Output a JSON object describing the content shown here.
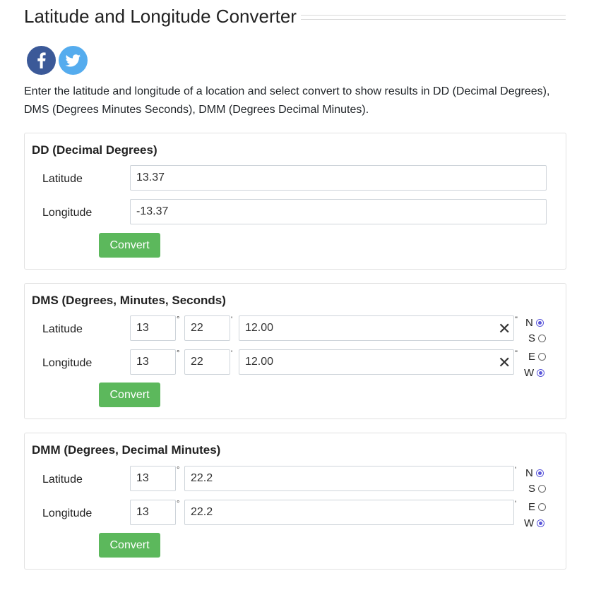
{
  "page": {
    "title": "Latitude and Longitude Converter",
    "intro": "Enter the latitude and longitude of a location and select convert to show results in DD (Decimal Degrees), DMS (Degrees Minutes Seconds), DMM (Degrees Decimal Minutes)."
  },
  "social": {
    "facebook_icon": "facebook-icon",
    "twitter_icon": "twitter-icon",
    "facebook_color": "#3b5998",
    "twitter_color": "#55acee"
  },
  "dd": {
    "title": "DD (Decimal Degrees)",
    "latitude_label": "Latitude",
    "longitude_label": "Longitude",
    "latitude_value": "13.37",
    "longitude_value": "-13.37",
    "convert_label": "Convert"
  },
  "dms": {
    "title": "DMS (Degrees, Minutes, Seconds)",
    "latitude_label": "Latitude",
    "longitude_label": "Longitude",
    "lat_degrees": "13",
    "lat_minutes": "22",
    "lat_seconds": "12.00",
    "lon_degrees": "13",
    "lon_minutes": "22",
    "lon_seconds": "12.00",
    "degree_symbol": "°",
    "minute_symbol": "'",
    "second_symbol": "\"",
    "clear_glyph": "✕",
    "convert_label": "Convert",
    "directions": {
      "n": "N",
      "s": "S",
      "e": "E",
      "w": "W"
    },
    "lat_direction_selected": "N",
    "lon_direction_selected": "W"
  },
  "dmm": {
    "title": "DMM (Degrees, Decimal Minutes)",
    "latitude_label": "Latitude",
    "longitude_label": "Longitude",
    "lat_degrees": "13",
    "lat_minutes": "22.2",
    "lon_degrees": "13",
    "lon_minutes": "22.2",
    "degree_symbol": "°",
    "minute_symbol": "'",
    "convert_label": "Convert",
    "directions": {
      "n": "N",
      "s": "S",
      "e": "E",
      "w": "W"
    },
    "lat_direction_selected": "N",
    "lon_direction_selected": "W"
  },
  "colors": {
    "button": "#5cb85c",
    "radio_accent": "#5b57d9",
    "card_border": "#e1e1e1"
  }
}
